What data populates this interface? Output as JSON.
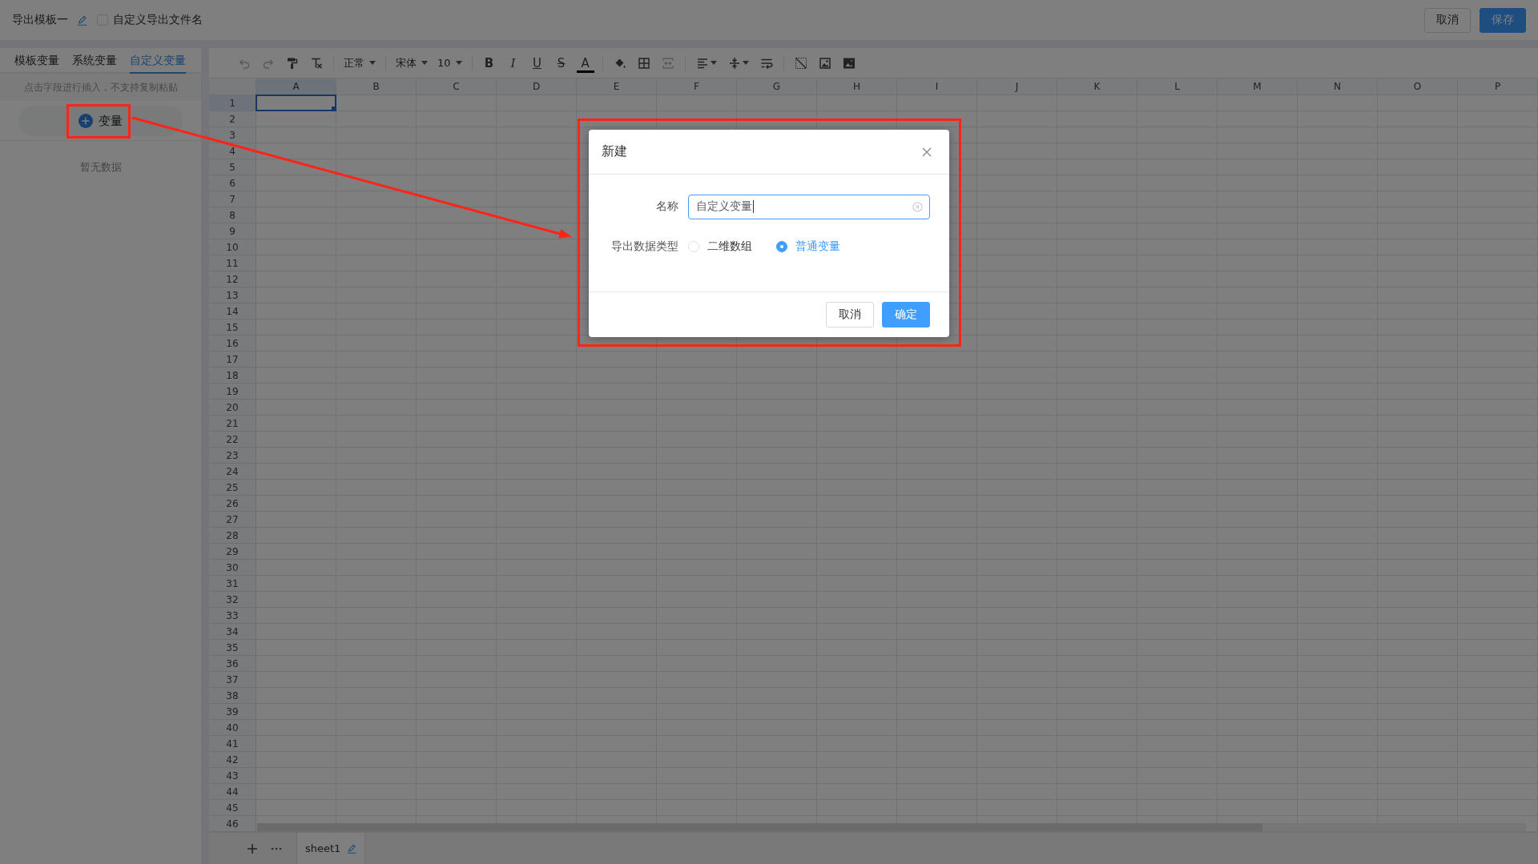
{
  "header": {
    "title": "导出模板一",
    "custom_filename": {
      "label": "自定义导出文件名",
      "checked": false
    },
    "buttons": [
      {
        "label": "取消",
        "kind": "default"
      },
      {
        "label": "保存",
        "kind": "primary"
      }
    ]
  },
  "variable_panel": {
    "tabs": [
      {
        "label": "模板变量",
        "selected": false
      },
      {
        "label": "系统变量",
        "selected": false
      },
      {
        "label": "自定义变量",
        "selected": true
      }
    ],
    "hint": "点击字段进行插入，不支持复制粘贴",
    "add_button": {
      "label": "变量"
    },
    "empty_text": "暂无数据"
  },
  "toolbar": {
    "undo": {
      "disabled": true
    },
    "redo": {
      "disabled": true
    },
    "paragraph_style": "正常",
    "font_family": "宋体",
    "font_size": "10",
    "text_styles": [
      {
        "kind": "bold",
        "label": "B"
      },
      {
        "kind": "italic",
        "label": "I"
      },
      {
        "kind": "underline",
        "label": "U"
      },
      {
        "kind": "strike",
        "label": "S"
      },
      {
        "kind": "color",
        "label": "A"
      }
    ],
    "merge_cells": {
      "disabled": true
    }
  },
  "sheet": {
    "columns": [
      {
        "label": "A",
        "selected": true
      },
      {
        "label": "B",
        "selected": false
      },
      {
        "label": "C",
        "selected": false
      },
      {
        "label": "D",
        "selected": false
      },
      {
        "label": "E",
        "selected": false
      },
      {
        "label": "F",
        "selected": false
      },
      {
        "label": "G",
        "selected": false
      },
      {
        "label": "H",
        "selected": false
      },
      {
        "label": "I",
        "selected": false
      },
      {
        "label": "J",
        "selected": false
      },
      {
        "label": "K",
        "selected": false
      },
      {
        "label": "L",
        "selected": false
      },
      {
        "label": "M",
        "selected": false
      },
      {
        "label": "N",
        "selected": false
      },
      {
        "label": "O",
        "selected": false
      },
      {
        "label": "P",
        "selected": false
      }
    ],
    "rows": [
      {
        "label": "1",
        "selected": true
      },
      {
        "label": "2",
        "selected": false
      },
      {
        "label": "3",
        "selected": false
      },
      {
        "label": "4",
        "selected": false
      },
      {
        "label": "5",
        "selected": false
      },
      {
        "label": "6",
        "selected": false
      },
      {
        "label": "7",
        "selected": false
      },
      {
        "label": "8",
        "selected": false
      },
      {
        "label": "9",
        "selected": false
      },
      {
        "label": "10",
        "selected": false
      },
      {
        "label": "11",
        "selected": false
      },
      {
        "label": "12",
        "selected": false
      },
      {
        "label": "13",
        "selected": false
      },
      {
        "label": "14",
        "selected": false
      },
      {
        "label": "15",
        "selected": false
      },
      {
        "label": "16",
        "selected": false
      },
      {
        "label": "17",
        "selected": false
      },
      {
        "label": "18",
        "selected": false
      },
      {
        "label": "19",
        "selected": false
      },
      {
        "label": "20",
        "selected": false
      },
      {
        "label": "21",
        "selected": false
      },
      {
        "label": "22",
        "selected": false
      },
      {
        "label": "23",
        "selected": false
      },
      {
        "label": "24",
        "selected": false
      },
      {
        "label": "25",
        "selected": false
      },
      {
        "label": "26",
        "selected": false
      },
      {
        "label": "27",
        "selected": false
      },
      {
        "label": "28",
        "selected": false
      },
      {
        "label": "29",
        "selected": false
      },
      {
        "label": "30",
        "selected": false
      },
      {
        "label": "31",
        "selected": false
      },
      {
        "label": "32",
        "selected": false
      },
      {
        "label": "33",
        "selected": false
      },
      {
        "label": "34",
        "selected": false
      },
      {
        "label": "35",
        "selected": false
      },
      {
        "label": "36",
        "selected": false
      },
      {
        "label": "37",
        "selected": false
      },
      {
        "label": "38",
        "selected": false
      },
      {
        "label": "39",
        "selected": false
      },
      {
        "label": "40",
        "selected": false
      },
      {
        "label": "41",
        "selected": false
      },
      {
        "label": "42",
        "selected": false
      },
      {
        "label": "43",
        "selected": false
      },
      {
        "label": "44",
        "selected": false
      },
      {
        "label": "45",
        "selected": false
      },
      {
        "label": "46",
        "selected": false
      }
    ]
  },
  "sheet_tabs": [
    {
      "label": "sheet1",
      "selected": true
    }
  ],
  "dialog": {
    "title": "新建",
    "fields": [
      {
        "kind": "text",
        "label": "名称",
        "value": "自定义变量",
        "focused": true
      },
      {
        "kind": "radio",
        "label": "导出数据类型",
        "options": [
          {
            "label": "二维数组",
            "selected": false
          },
          {
            "label": "普通变量",
            "selected": true
          }
        ]
      }
    ],
    "buttons": [
      {
        "label": "取消",
        "kind": "default"
      },
      {
        "label": "确定",
        "kind": "primary"
      }
    ]
  }
}
